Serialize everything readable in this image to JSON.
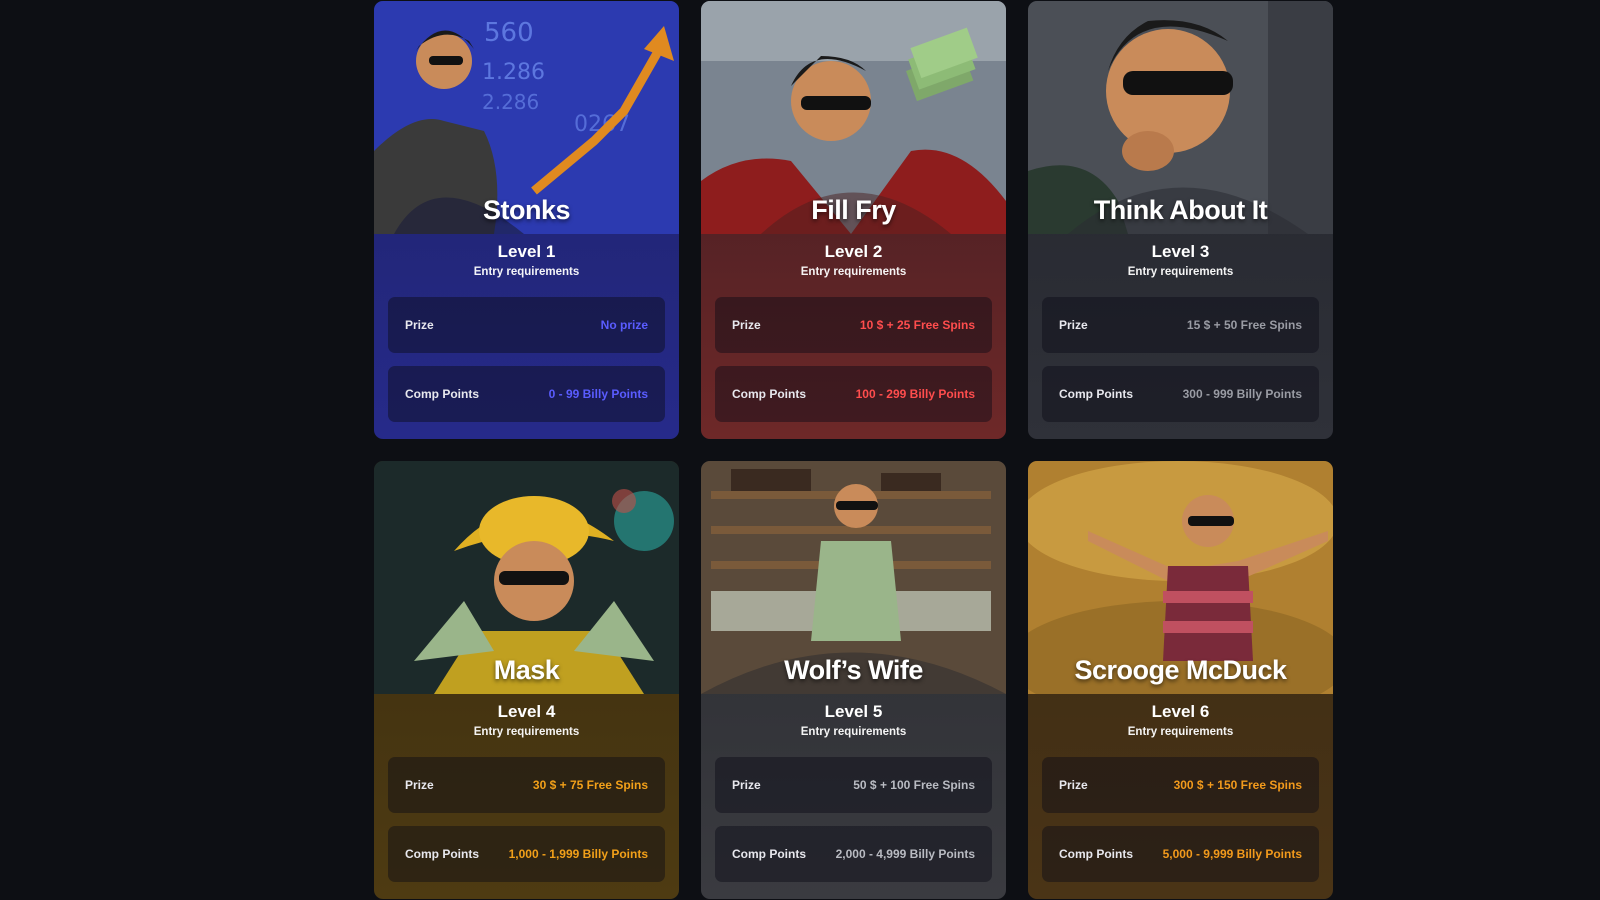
{
  "entry_label": "Entry requirements",
  "prize_label": "Prize",
  "comp_label": "Comp Points",
  "cards": [
    {
      "title": "Stonks",
      "level": "Level 1",
      "prize": "No prize",
      "comp": "0 - 99 Billy Points",
      "accent": "#5a5cff"
    },
    {
      "title": "Fill Fry",
      "level": "Level 2",
      "prize": "10 $ + 25 Free Spins",
      "comp": "100 - 299 Billy Points",
      "accent": "#ff4d4d"
    },
    {
      "title": "Think About It",
      "level": "Level 3",
      "prize": "15 $ + 50 Free Spins",
      "comp": "300 - 999 Billy Points",
      "accent": "#9a9ca4"
    },
    {
      "title": "Mask",
      "level": "Level 4",
      "prize": "30 $ + 75 Free Spins",
      "comp": "1,000 - 1,999 Billy Points",
      "accent": "#f2a019"
    },
    {
      "title": "Wolf’s Wife",
      "level": "Level 5",
      "prize": "50 $ + 100 Free Spins",
      "comp": "2,000 - 4,999 Billy Points",
      "accent": "#b9bbc2"
    },
    {
      "title": "Scrooge McDuck",
      "level": "Level 6",
      "prize": "300 $ + 150 Free Spins",
      "comp": "5,000 - 9,999 Billy Points",
      "accent": "#f29a1c"
    }
  ]
}
